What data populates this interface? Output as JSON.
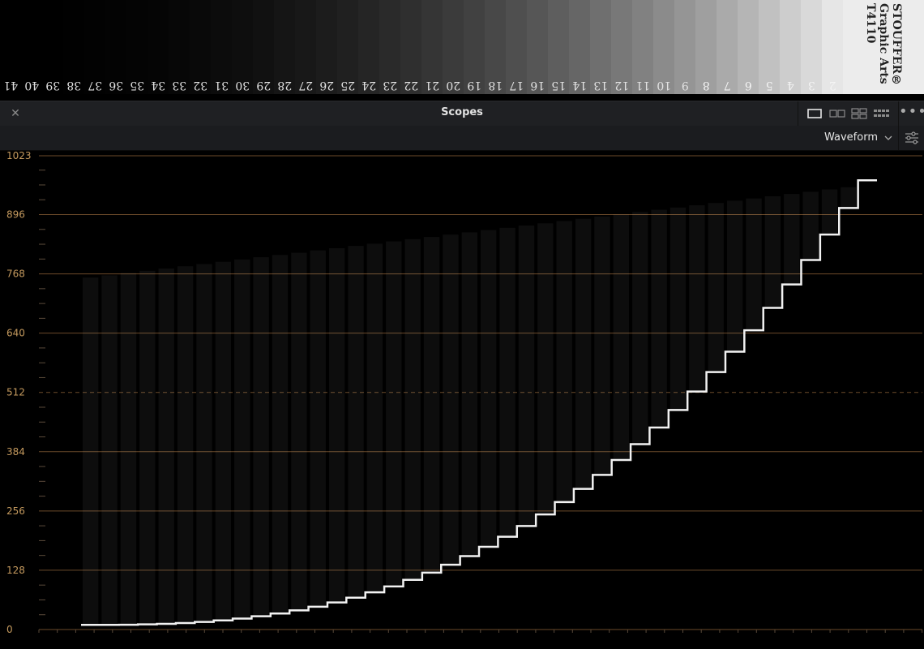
{
  "wedge": {
    "brand_lines": [
      "STOUFFER®",
      "Graphic Arts",
      "T4110"
    ],
    "steps": [
      "41",
      "40",
      "39",
      "38",
      "37",
      "36",
      "35",
      "34",
      "33",
      "32",
      "31",
      "30",
      "29",
      "28",
      "27",
      "26",
      "25",
      "24",
      "23",
      "22",
      "21",
      "20",
      "19",
      "18",
      "17",
      "16",
      "15",
      "14",
      "13",
      "12",
      "11",
      "10",
      "9",
      "8",
      "7",
      "6",
      "5",
      "4",
      "3",
      "2"
    ]
  },
  "panel": {
    "title": "Scopes",
    "close_icon": "close-icon",
    "layouts": [
      "single-view-icon",
      "dual-view-icon",
      "quad-view-icon",
      "grid-view-icon"
    ],
    "more_icon": "more-icon",
    "scope_type": "Waveform",
    "settings_icon": "settings-sliders-icon"
  },
  "waveform": {
    "y_ticks": [
      "1023",
      "896",
      "768",
      "640",
      "512",
      "384",
      "256",
      "128",
      "0"
    ],
    "grid_color": "#6b4a2a",
    "label_color": "#c59a5e"
  }
}
